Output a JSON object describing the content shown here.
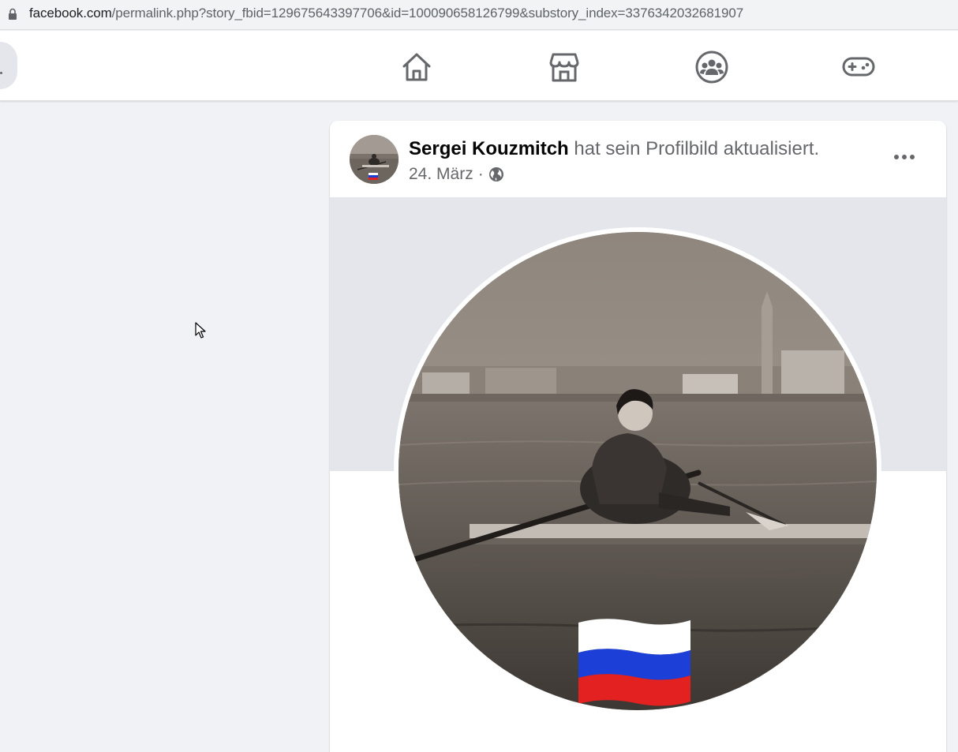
{
  "browser": {
    "url_domain": "facebook.com",
    "url_path": "/permalink.php?story_fbid=129675643397706&id=100090658126799&substory_index=3376342032681907"
  },
  "nav": {
    "icons": [
      "home-icon",
      "marketplace-icon",
      "groups-icon",
      "gaming-icon"
    ]
  },
  "post": {
    "author": "Sergei Kouzmitch",
    "action": " hat sein Profilbild aktualisiert.",
    "date": "24. März",
    "separator": " · ",
    "privacy_icon": "globe-icon"
  },
  "colors": {
    "background": "#f0f2f5",
    "card": "#ffffff",
    "secondary_text": "#65676b"
  }
}
